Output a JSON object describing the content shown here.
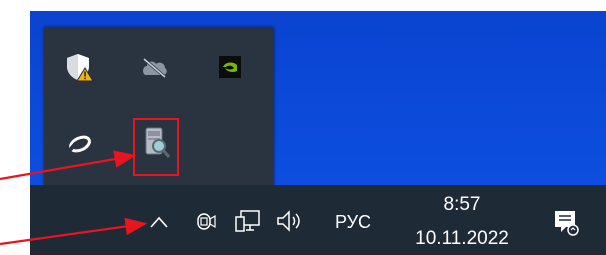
{
  "tray_overflow": {
    "icons": [
      {
        "name": "windows-security-warning-icon"
      },
      {
        "name": "onedrive-offline-icon"
      },
      {
        "name": "nvidia-icon"
      },
      {
        "name": "sync-ring-icon"
      },
      {
        "name": "disk-search-icon"
      }
    ]
  },
  "taskbar": {
    "show_hidden_icons": "chevron-up-icon",
    "meet_now": "meet-now-icon",
    "network": "network-icon",
    "volume": "volume-icon",
    "language": "РУС",
    "clock": {
      "time": "8:57",
      "date": "10.11.2022"
    },
    "notifications": "action-center-icon"
  },
  "annotations": {
    "highlight_color": "#e8141e",
    "arrow_color": "#e8141e"
  }
}
